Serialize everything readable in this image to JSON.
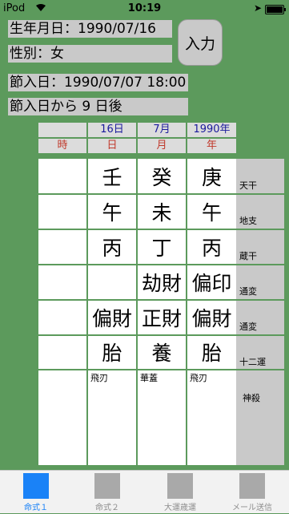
{
  "status": {
    "carrier": "iPod",
    "time": "10:19"
  },
  "info": {
    "birth": "生年月日：1990/07/16",
    "gender": "性別：女",
    "setsu_date": "節入日：1990/07/07 18:00",
    "setsu_after": "節入日から 9 日後",
    "input_label": "入力"
  },
  "columns": {
    "day_value": "16日",
    "month_value": "7月",
    "year_value": "1990年",
    "hour": "時",
    "day": "日",
    "month": "月",
    "year": "年"
  },
  "rows": {
    "tenkan": {
      "label": "天干",
      "day": "壬",
      "month": "癸",
      "year": "庚"
    },
    "chishi": {
      "label": "地支",
      "day": "午",
      "month": "未",
      "year": "午"
    },
    "zoukan": {
      "label": "蔵干",
      "day": "丙",
      "month": "丁",
      "year": "丙"
    },
    "tsuhen1": {
      "label": "通変",
      "day": "",
      "month": "劫財",
      "year": "偏印"
    },
    "tsuhen2": {
      "label": "通変",
      "day": "偏財",
      "month": "正財",
      "year": "偏財"
    },
    "juniun": {
      "label": "十二運",
      "day": "胎",
      "month": "養",
      "year": "胎"
    },
    "shinsatsu": {
      "label": "神殺",
      "day": "飛刃",
      "month": "華蓋",
      "year": "飛刃"
    }
  },
  "tabs": [
    {
      "label": "命式１",
      "active": true
    },
    {
      "label": "命式２",
      "active": false
    },
    {
      "label": "大運歳運",
      "active": false
    },
    {
      "label": "メール送信",
      "active": false
    }
  ]
}
